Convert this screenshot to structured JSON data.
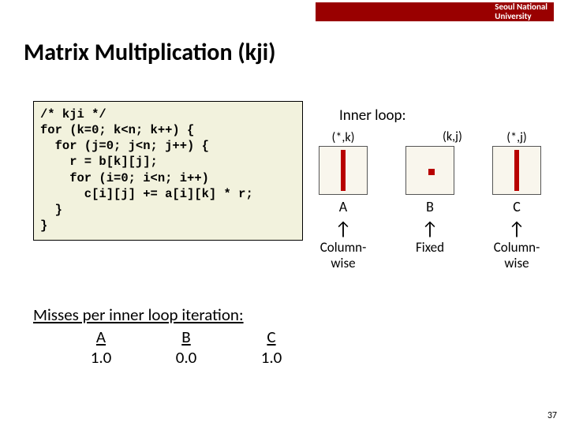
{
  "header": {
    "org": "Seoul National\nUniversity"
  },
  "title": "Matrix Multiplication (kji)",
  "code": "/* kji */\nfor (k=0; k<n; k++) {\n  for (j=0; j<n; j++) {\n    r = b[k][j];\n    for (i=0; i<n; i++)\n      c[i][j] += a[i][k] * r;\n  }\n}",
  "inner": {
    "title": "Inner loop:",
    "mats": {
      "A": {
        "top": "(*,k)",
        "name": "A",
        "access": "Column-\nwise"
      },
      "B": {
        "top": "(k,j)",
        "name": "B",
        "access": "Fixed"
      },
      "C": {
        "top": "(*,j)",
        "name": "C",
        "access": "Column-\nwise"
      }
    }
  },
  "misses": {
    "heading": "Misses per inner loop iteration:",
    "cols": [
      {
        "h": "A",
        "v": "1.0"
      },
      {
        "h": "B",
        "v": "0.0"
      },
      {
        "h": "C",
        "v": "1.0"
      }
    ]
  },
  "page": "37"
}
